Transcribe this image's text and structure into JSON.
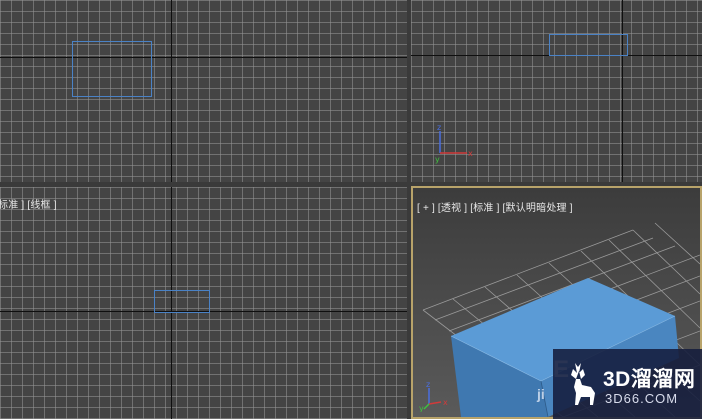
{
  "viewports": {
    "bottom_left": {
      "label": "标准 ] [线框 ]"
    },
    "bottom_right": {
      "label": "[ + ] [透视 ] [标准 ] [默认明暗处理 ]"
    }
  },
  "gizmo_axes": {
    "x": "x",
    "y": "y",
    "z": "z"
  },
  "colors": {
    "viewport_bg": "#444444",
    "grid_line": "#969696",
    "axis_line": "#0f0f0f",
    "selection_wire": "#4a82c6",
    "box_front": "#4a86c0",
    "box_top": "#5b9bd6",
    "active_border": "#b8a36a"
  },
  "watermark": {
    "brand": "3D溜溜网",
    "site": "3D66.COM",
    "partial_text": "E",
    "partial_sub": "ji"
  }
}
